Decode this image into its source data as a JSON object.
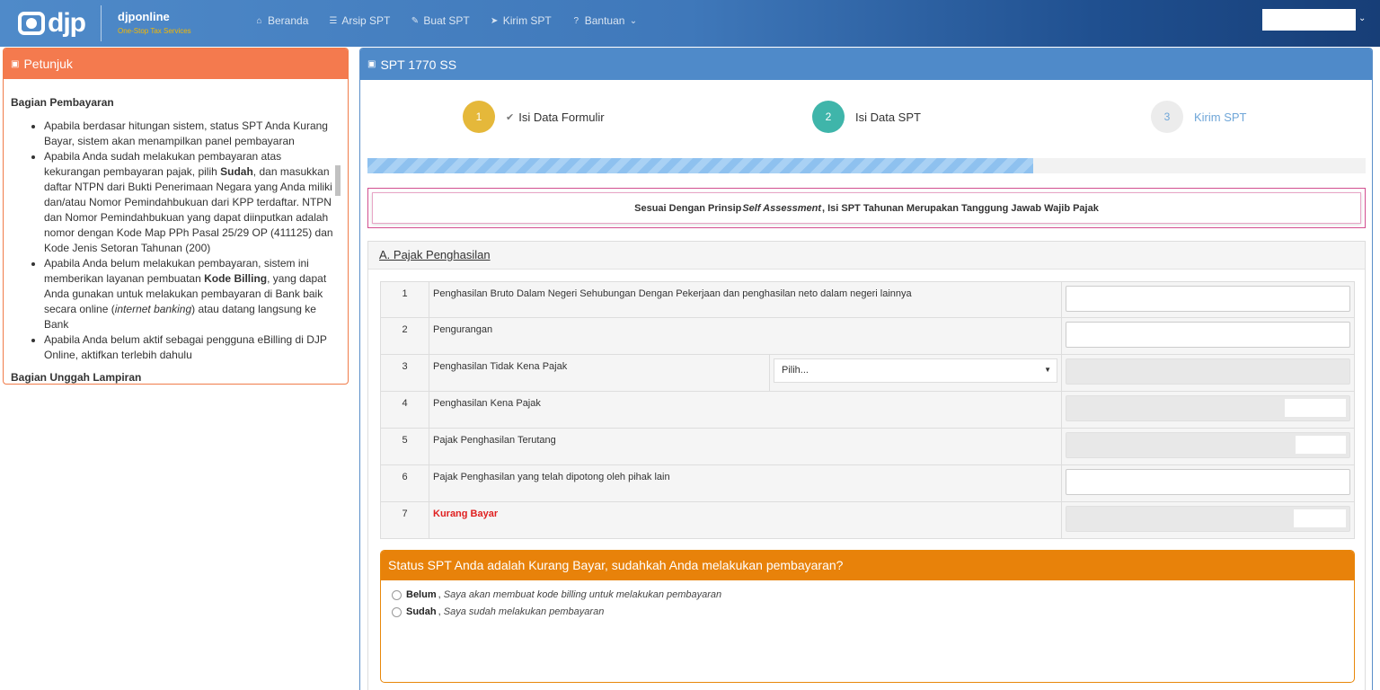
{
  "navbar": {
    "logo_text": "djp",
    "brand_name": "djponline",
    "brand_sub": "One-Stop Tax Services",
    "menu": [
      {
        "label": "Beranda",
        "icon": "home-icon"
      },
      {
        "label": "Arsip SPT",
        "icon": "list-icon"
      },
      {
        "label": "Buat SPT",
        "icon": "edit-icon"
      },
      {
        "label": "Kirim SPT",
        "icon": "send-icon"
      },
      {
        "label": "Bantuan",
        "icon": "help-icon"
      }
    ]
  },
  "petunjuk": {
    "title": "Petunjuk",
    "section1_title": "Bagian Pembayaran",
    "items": [
      "Apabila berdasar hitungan sistem, status SPT Anda Kurang Bayar, sistem akan menampilkan panel pembayaran",
      {
        "pre": "Apabila Anda sudah melakukan pembayaran atas kekurangan pembayaran pajak, pilih ",
        "bold": "Sudah",
        "post": ", dan masukkan daftar NTPN dari Bukti Penerimaan Negara yang Anda miliki dan/atau Nomor Pemindahbukuan dari KPP terdaftar. NTPN dan Nomor Pemindahbukuan yang dapat diinputkan adalah nomor dengan Kode Map PPh Pasal 25/29 OP (411125) dan Kode Jenis Setoran Tahunan (200)"
      },
      {
        "pre": "Apabila Anda belum melakukan pembayaran, sistem ini memberikan layanan pembuatan ",
        "bold": "Kode Billing",
        "mid": ", yang dapat Anda gunakan untuk melakukan pembayaran di Bank baik secara online (",
        "italic": "internet banking",
        "post": ") atau datang langsung ke Bank"
      },
      "Apabila Anda belum aktif sebagai pengguna eBilling di DJP Online, aktifkan terlebih dahulu"
    ],
    "section2_title": "Bagian Unggah Lampiran"
  },
  "main": {
    "title": "SPT 1770 SS",
    "steps": [
      {
        "num": "1",
        "label": "Isi Data Formulir"
      },
      {
        "num": "2",
        "label": "Isi Data SPT"
      },
      {
        "num": "3",
        "label": "Kirim SPT"
      }
    ],
    "progress": 0.667,
    "notice_pre": "Sesuai Dengan Prinsip ",
    "notice_italic": "Self Assessment",
    "notice_post": ", Isi SPT Tahunan Merupakan Tanggung Jawab Wajib Pajak",
    "section_title": "A. Pajak Penghasilan",
    "rows": [
      {
        "no": "1",
        "label": "Penghasilan Bruto Dalam Negeri Sehubungan Dengan Pekerjaan dan penghasilan neto dalam negeri lainnya"
      },
      {
        "no": "2",
        "label": "Pengurangan"
      },
      {
        "no": "3",
        "label": "Penghasilan Tidak Kena Pajak",
        "select": "Pilih..."
      },
      {
        "no": "4",
        "label": "Penghasilan Kena Pajak"
      },
      {
        "no": "5",
        "label": "Pajak Penghasilan Terutang"
      },
      {
        "no": "6",
        "label": "Pajak Penghasilan yang telah dipotong oleh pihak lain"
      },
      {
        "no": "7",
        "label": "Kurang Bayar"
      }
    ],
    "payment": {
      "question": "Status SPT Anda adalah Kurang Bayar, sudahkah Anda melakukan pembayaran?",
      "opt1_bold": "Belum",
      "opt1_text": "Saya akan membuat kode billing untuk melakukan pembayaran",
      "opt2_bold": "Sudah",
      "opt2_text": "Saya sudah melakukan pembayaran"
    }
  }
}
